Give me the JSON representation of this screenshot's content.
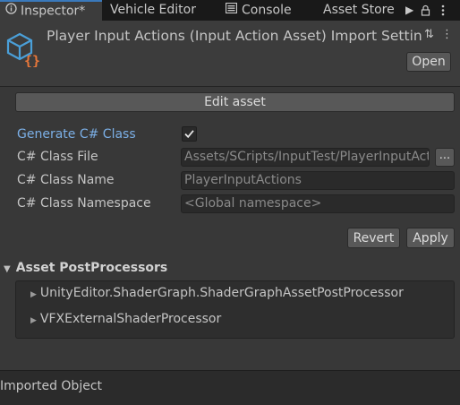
{
  "tabs": [
    {
      "label": "Inspector*",
      "active": true
    },
    {
      "label": "Vehicle Editor",
      "active": false
    },
    {
      "label": "Console",
      "active": false
    },
    {
      "label": "Asset Store",
      "active": false
    }
  ],
  "tab_icons": {
    "inspector": "info-icon",
    "console": "console-icon",
    "overflow": "play-arrow-icon",
    "lock": "lock-icon",
    "menu": "kebab-menu-icon"
  },
  "header": {
    "title": "Player Input Actions (Input Action Asset) Import Settings",
    "open_label": "Open",
    "icon": "input-action-asset-icon"
  },
  "edit_asset_label": "Edit asset",
  "settings": {
    "generate_label": "Generate C# Class",
    "generate_checked": true,
    "file_label": "C# Class File",
    "file_value": "Assets/SCripts/InputTest/PlayerInputActions.cs",
    "name_label": "C# Class Name",
    "name_placeholder": "PlayerInputActions",
    "namespace_label": "C# Class Namespace",
    "namespace_placeholder": "<Global namespace>",
    "browse_label": "..."
  },
  "actions": {
    "revert": "Revert",
    "apply": "Apply"
  },
  "postprocessors": {
    "title": "Asset PostProcessors",
    "items": [
      {
        "label": "UnityEditor.ShaderGraph.ShaderGraphAssetPostProcessor"
      },
      {
        "label": "VFXExternalShaderProcessor"
      }
    ]
  },
  "footer": {
    "label": "Imported Object"
  },
  "colors": {
    "accent": "#3a79bb",
    "label_blue": "#7bafe6",
    "icon_blue": "#4a9fd8",
    "icon_orange": "#e8773a"
  }
}
